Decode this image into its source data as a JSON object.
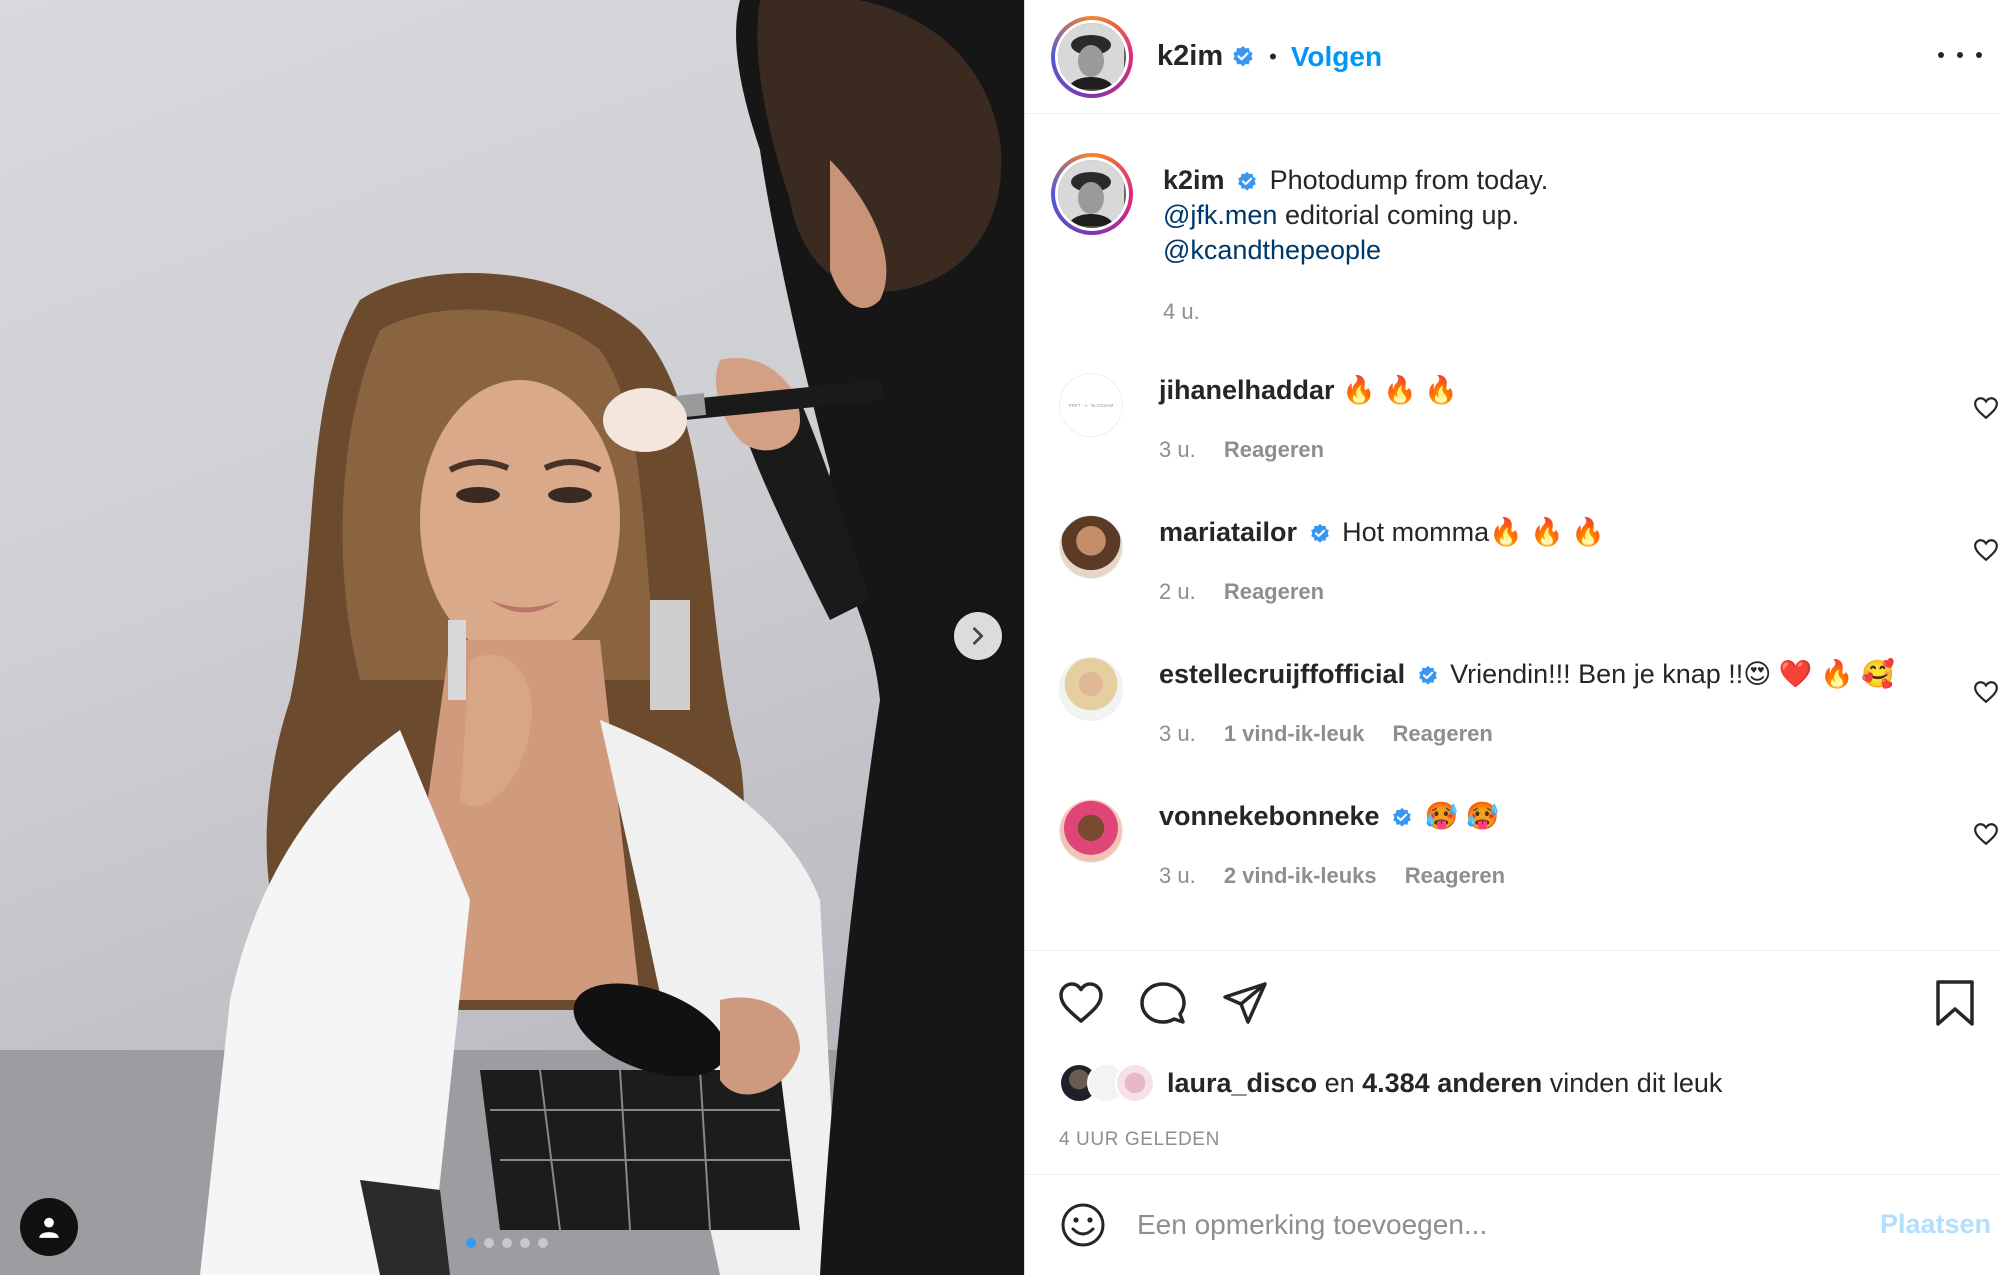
{
  "post": {
    "image_dots": 5,
    "active_dot": 0
  },
  "header": {
    "username": "k2im",
    "separator": "•",
    "follow_label": "Volgen"
  },
  "caption": {
    "username": "k2im",
    "text_line1": "Photodump from today.",
    "mention1": "@jfk.men",
    "text_line2": " editorial coming up.",
    "mention2": "@kcandthepeople",
    "time": "4 u."
  },
  "comments": [
    {
      "username": "jihanelhaddar",
      "verified": false,
      "text": " 🔥 🔥 🔥",
      "time": "3 u.",
      "likes": "",
      "reply": "Reageren"
    },
    {
      "username": "mariatailor",
      "verified": true,
      "text": " Hot momma🔥 🔥 🔥",
      "time": "2 u.",
      "likes": "",
      "reply": "Reageren"
    },
    {
      "username": "estellecruijffofficial",
      "verified": true,
      "text": " Vriendin!!! Ben je knap !!😍 ❤️ 🔥 🥰",
      "time": "3 u.",
      "likes": "1 vind-ik-leuk",
      "reply": "Reageren"
    },
    {
      "username": "vonnekebonneke",
      "verified": true,
      "text": " 🥵 🥵",
      "time": "3 u.",
      "likes": "2 vind-ik-leuks",
      "reply": "Reageren"
    }
  ],
  "likes": {
    "first_user": "laura_disco",
    "connector": " en ",
    "others": "4.384 anderen",
    "suffix": " vinden dit leuk"
  },
  "timestamp": "4 UUR GELEDEN",
  "add_comment": {
    "placeholder": "Een opmerking toevoegen...",
    "post_label": "Plaatsen"
  },
  "colors": {
    "link_blue": "#0095f6",
    "mention_blue": "#00376b",
    "verified_blue": "#3897f0",
    "muted": "#8e8e8e"
  },
  "icons": [
    "chevron-right-icon",
    "user-tag-icon",
    "verified-icon",
    "more-icon",
    "heart-icon",
    "comment-icon",
    "share-icon",
    "bookmark-icon",
    "smiley-icon"
  ]
}
